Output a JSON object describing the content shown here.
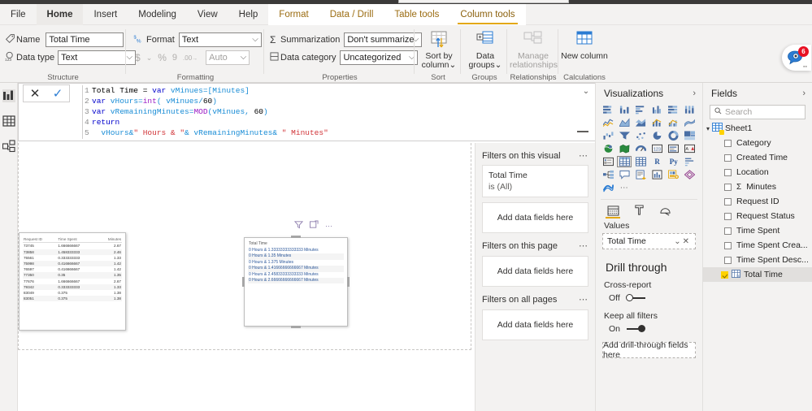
{
  "ribbon": {
    "tabs": [
      {
        "label": "File",
        "kind": "plain"
      },
      {
        "label": "Home",
        "kind": "home"
      },
      {
        "label": "Insert",
        "kind": "plain"
      },
      {
        "label": "Modeling",
        "kind": "plain"
      },
      {
        "label": "View",
        "kind": "plain"
      },
      {
        "label": "Help",
        "kind": "plain"
      },
      {
        "label": "Format",
        "kind": "contextual"
      },
      {
        "label": "Data / Drill",
        "kind": "contextual"
      },
      {
        "label": "Table tools",
        "kind": "contextual"
      },
      {
        "label": "Column tools",
        "kind": "contextual-active"
      }
    ],
    "groups": {
      "structure": {
        "label": "Structure",
        "name_label": "Name",
        "name_value": "Total Time",
        "datatype_label": "Data type",
        "datatype_value": "Text"
      },
      "formatting": {
        "label": "Formatting",
        "format_label": "Format",
        "format_value": "Text",
        "currency_glyph": "$",
        "percent_glyph": "%",
        "comma_glyph": "9",
        "decimal_glyph": ".00",
        "auto_value": "Auto"
      },
      "properties": {
        "label": "Properties",
        "summarization_label": "Summarization",
        "summarization_value": "Don't summarize",
        "datacategory_label": "Data category",
        "datacategory_value": "Uncategorized"
      },
      "sort": {
        "label": "Sort",
        "button": "Sort by column"
      },
      "groups": {
        "label": "Groups",
        "button": "Data groups"
      },
      "relationships": {
        "label": "Relationships",
        "button": "Manage relationships"
      },
      "calculations": {
        "label": "Calculations",
        "button": "New column"
      }
    }
  },
  "formula_bar": {
    "cancel_icon": "close-icon",
    "accept_icon": "check-icon",
    "lines": [
      {
        "n": "1",
        "tokens": [
          {
            "t": "Total Time = ",
            "c": "plain"
          },
          {
            "t": "var",
            "c": "def"
          },
          {
            "t": " vMinues=[Minutes]",
            "c": "var"
          }
        ]
      },
      {
        "n": "2",
        "tokens": [
          {
            "t": "var",
            "c": "def"
          },
          {
            "t": " vHours=",
            "c": "var"
          },
          {
            "t": "int",
            "c": "fn"
          },
          {
            "t": "( vMinues/",
            "c": "var"
          },
          {
            "t": "60",
            "c": "num"
          },
          {
            "t": ")",
            "c": "var"
          }
        ]
      },
      {
        "n": "3",
        "tokens": [
          {
            "t": "var",
            "c": "def"
          },
          {
            "t": " vRemainingMinutes=",
            "c": "var"
          },
          {
            "t": "MOD",
            "c": "fn"
          },
          {
            "t": "(vMinues, ",
            "c": "var"
          },
          {
            "t": "60",
            "c": "num"
          },
          {
            "t": ")",
            "c": "var"
          }
        ]
      },
      {
        "n": "4",
        "tokens": [
          {
            "t": "return",
            "c": "def"
          }
        ]
      },
      {
        "n": "5",
        "tokens": [
          {
            "t": "  vHours&",
            "c": "var"
          },
          {
            "t": "\" Hours & \"",
            "c": "str"
          },
          {
            "t": "& vRemainingMinutes& ",
            "c": "var"
          },
          {
            "t": "\" Minutes\"",
            "c": "str"
          }
        ]
      }
    ]
  },
  "left_rail": {
    "items": [
      {
        "icon": "report-view-icon",
        "active": true
      },
      {
        "icon": "data-view-icon",
        "active": false
      },
      {
        "icon": "model-view-icon",
        "active": false
      }
    ]
  },
  "canvas": {
    "table_visual": {
      "columns": [
        "Request ID",
        "Time Spent",
        "Minutes"
      ],
      "rows": [
        [
          "73745",
          "1.666666667",
          "2.67"
        ],
        [
          "73858",
          "1.458333333",
          "2.46"
        ],
        [
          "75561",
          "0.333333333",
          "1.33"
        ],
        [
          "75998",
          "0.416666667",
          "1.42"
        ],
        [
          "76597",
          "0.416666667",
          "1.42"
        ],
        [
          "77350",
          "0.35",
          "1.35"
        ],
        [
          "77676",
          "1.666666667",
          "2.67"
        ],
        [
          "79342",
          "0.333333333",
          "1.33"
        ],
        [
          "83049",
          "0.375",
          "1.38"
        ],
        [
          "83051",
          "0.375",
          "1.38"
        ]
      ]
    },
    "card_visual": {
      "header_icons": [
        "filter-icon",
        "focus-mode-icon",
        "more-options-icon"
      ],
      "title": "Total Time",
      "rows": [
        "0 Hours & 1.33333333333333 Minutes",
        "0 Hours & 1.35 Minutes",
        "0 Hours & 1.375 Minutes",
        "0 Hours & 1.41666666666667 Minutes",
        "0 Hours & 2.45833333333333 Minutes",
        "0 Hours & 2.66666666666667 Minutes"
      ]
    }
  },
  "filters_pane": {
    "sections": [
      {
        "title": "Filters on this visual",
        "cards": [
          {
            "name": "Total Time",
            "value": "is (All)"
          }
        ],
        "dropzone": "Add data fields here"
      },
      {
        "title": "Filters on this page",
        "cards": [],
        "dropzone": "Add data fields here"
      },
      {
        "title": "Filters on all pages",
        "cards": [],
        "dropzone": "Add data fields here"
      }
    ]
  },
  "visualizations_pane": {
    "title": "Visualizations",
    "collapse_icon": "chevron-right-icon",
    "icons": [
      "stacked-bar-chart-icon",
      "stacked-column-chart-icon",
      "clustered-bar-chart-icon",
      "clustered-column-chart-icon",
      "100-stacked-bar-chart-icon",
      "100-stacked-column-chart-icon",
      "line-chart-icon",
      "area-chart-icon",
      "stacked-area-chart-icon",
      "line-stacked-column-icon",
      "line-clustered-column-icon",
      "ribbon-chart-icon",
      "waterfall-chart-icon",
      "funnel-chart-icon",
      "scatter-chart-icon",
      "pie-chart-icon",
      "donut-chart-icon",
      "treemap-icon",
      "map-icon",
      "filled-map-icon",
      "gauge-icon",
      "card-icon",
      "multi-row-card-icon",
      "kpi-icon",
      "slicer-icon",
      "table-icon",
      "matrix-icon",
      "r-script-visual-icon",
      "python-visual-icon",
      "key-influencers-icon",
      "decomposition-tree-icon",
      "q-and-a-icon",
      "smart-narrative-icon",
      "paginated-report-icon",
      "get-more-visuals-icon",
      "power-apps-icon",
      "power-automate-icon",
      "more-options-icon"
    ],
    "selected_icon": "table-icon",
    "field_tabs": [
      "fields-tab-icon",
      "format-tab-icon",
      "analytics-tab-icon"
    ],
    "active_field_tab": 0,
    "well_header": "Values",
    "well_items": [
      {
        "name": "Total Time",
        "chevron": "chevron-down-icon",
        "remove": "close-icon"
      }
    ],
    "drill_through": {
      "title": "Drill through",
      "cross_report_label": "Cross-report",
      "cross_report_state": "Off",
      "keep_filters_label": "Keep all filters",
      "keep_filters_state": "On",
      "dropzone": "Add drill-through fields here"
    }
  },
  "fields_pane": {
    "title": "Fields",
    "collapse_icon": "chevron-right-icon",
    "search_placeholder": "Search",
    "search_icon": "search-icon",
    "table": {
      "name": "Sheet1",
      "expand_icon": "chevron-down-icon",
      "fields": [
        {
          "label": "Category",
          "checked": false,
          "measure": false,
          "calculated": false
        },
        {
          "label": "Created Time",
          "checked": false,
          "measure": false,
          "calculated": false
        },
        {
          "label": "Location",
          "checked": false,
          "measure": false,
          "calculated": false
        },
        {
          "label": "Minutes",
          "checked": false,
          "measure": true,
          "calculated": false
        },
        {
          "label": "Request ID",
          "checked": false,
          "measure": false,
          "calculated": false
        },
        {
          "label": "Request Status",
          "checked": false,
          "measure": false,
          "calculated": false
        },
        {
          "label": "Time Spent",
          "checked": false,
          "measure": false,
          "calculated": false
        },
        {
          "label": "Time Spent Crea...",
          "checked": false,
          "measure": false,
          "calculated": false
        },
        {
          "label": "Time Spent Desc...",
          "checked": false,
          "measure": false,
          "calculated": false
        },
        {
          "label": "Total Time",
          "checked": true,
          "measure": false,
          "calculated": true
        }
      ]
    }
  },
  "help_bubble": {
    "icon": "help-chat-icon",
    "badge": "6"
  },
  "colors": {
    "accent_yellow": "#e3a815",
    "contextual_tab_text": "#9b6c11",
    "pane_bg": "#f3f2f1",
    "badge_red": "#e81123",
    "card_text_blue": "#2b579a"
  }
}
